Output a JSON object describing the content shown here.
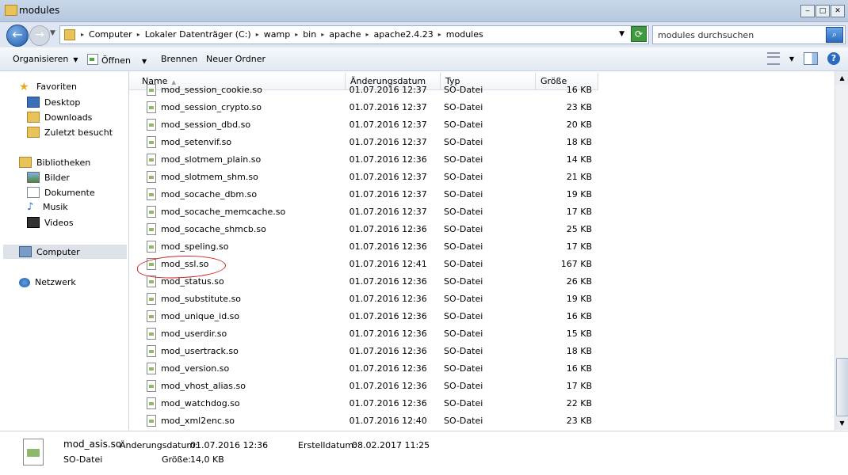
{
  "window": {
    "title": "modules"
  },
  "address": {
    "crumbs": [
      "Computer",
      "Lokaler Datenträger (C:)",
      "wamp",
      "bin",
      "apache",
      "apache2.4.23",
      "modules"
    ],
    "search_placeholder": "modules durchsuchen"
  },
  "toolbar": {
    "organize": "Organisieren",
    "open": "Öffnen",
    "burn": "Brennen",
    "new_folder": "Neuer Ordner"
  },
  "nav": {
    "favorites": "Favoriten",
    "desktop": "Desktop",
    "downloads": "Downloads",
    "recent": "Zuletzt besucht",
    "libraries": "Bibliotheken",
    "pictures": "Bilder",
    "documents": "Dokumente",
    "music": "Musik",
    "videos": "Videos",
    "computer": "Computer",
    "network": "Netzwerk"
  },
  "columns": {
    "name": "Name",
    "date": "Änderungsdatum",
    "type": "Typ",
    "size": "Größe"
  },
  "files": [
    {
      "name": "mod_session_cookie.so",
      "date": "01.07.2016 12:37",
      "type": "SO-Datei",
      "size": "16 KB"
    },
    {
      "name": "mod_session_crypto.so",
      "date": "01.07.2016 12:37",
      "type": "SO-Datei",
      "size": "23 KB"
    },
    {
      "name": "mod_session_dbd.so",
      "date": "01.07.2016 12:37",
      "type": "SO-Datei",
      "size": "20 KB"
    },
    {
      "name": "mod_setenvif.so",
      "date": "01.07.2016 12:37",
      "type": "SO-Datei",
      "size": "18 KB"
    },
    {
      "name": "mod_slotmem_plain.so",
      "date": "01.07.2016 12:36",
      "type": "SO-Datei",
      "size": "14 KB"
    },
    {
      "name": "mod_slotmem_shm.so",
      "date": "01.07.2016 12:37",
      "type": "SO-Datei",
      "size": "21 KB"
    },
    {
      "name": "mod_socache_dbm.so",
      "date": "01.07.2016 12:37",
      "type": "SO-Datei",
      "size": "19 KB"
    },
    {
      "name": "mod_socache_memcache.so",
      "date": "01.07.2016 12:37",
      "type": "SO-Datei",
      "size": "17 KB"
    },
    {
      "name": "mod_socache_shmcb.so",
      "date": "01.07.2016 12:36",
      "type": "SO-Datei",
      "size": "25 KB"
    },
    {
      "name": "mod_speling.so",
      "date": "01.07.2016 12:36",
      "type": "SO-Datei",
      "size": "17 KB"
    },
    {
      "name": "mod_ssl.so",
      "date": "01.07.2016 12:41",
      "type": "SO-Datei",
      "size": "167 KB"
    },
    {
      "name": "mod_status.so",
      "date": "01.07.2016 12:36",
      "type": "SO-Datei",
      "size": "26 KB"
    },
    {
      "name": "mod_substitute.so",
      "date": "01.07.2016 12:36",
      "type": "SO-Datei",
      "size": "19 KB"
    },
    {
      "name": "mod_unique_id.so",
      "date": "01.07.2016 12:36",
      "type": "SO-Datei",
      "size": "16 KB"
    },
    {
      "name": "mod_userdir.so",
      "date": "01.07.2016 12:36",
      "type": "SO-Datei",
      "size": "15 KB"
    },
    {
      "name": "mod_usertrack.so",
      "date": "01.07.2016 12:36",
      "type": "SO-Datei",
      "size": "18 KB"
    },
    {
      "name": "mod_version.so",
      "date": "01.07.2016 12:36",
      "type": "SO-Datei",
      "size": "16 KB"
    },
    {
      "name": "mod_vhost_alias.so",
      "date": "01.07.2016 12:36",
      "type": "SO-Datei",
      "size": "17 KB"
    },
    {
      "name": "mod_watchdog.so",
      "date": "01.07.2016 12:36",
      "type": "SO-Datei",
      "size": "22 KB"
    },
    {
      "name": "mod_xml2enc.so",
      "date": "01.07.2016 12:40",
      "type": "SO-Datei",
      "size": "23 KB"
    }
  ],
  "details": {
    "filename": "mod_asis.so",
    "modified_label": "Änderungsdatum:",
    "modified_value": "01.07.2016 12:36",
    "created_label": "Erstelldatum:",
    "created_value": "08.02.2017 11:25",
    "type": "SO-Datei",
    "size_label": "Größe:",
    "size_value": "14,0 KB"
  },
  "colors": {
    "highlight_circle": "#cc2222",
    "titlebar": "#c8d6e8"
  }
}
